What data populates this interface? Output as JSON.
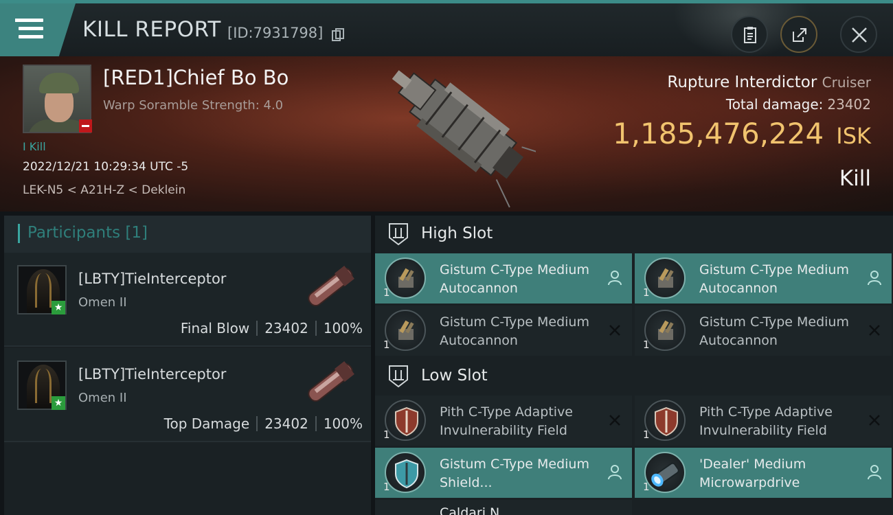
{
  "header": {
    "title": "KILL REPORT",
    "report_id": "[ID:7931798]"
  },
  "victim": {
    "name": "[RED1]Chief Bo Bo",
    "subtitle": "Warp Soramble Strength: 4.0",
    "kill_tag": "I Kill",
    "datetime": "2022/12/21 10:29:34 UTC -5",
    "location": "LEK-N5 < A21H-Z < Deklein",
    "ship_name": "Rupture Interdictor",
    "ship_class": "Cruiser",
    "total_damage_label": "Total damage:",
    "total_damage": "23402",
    "isk_value": "1,185,476,224",
    "isk_unit": "ISK",
    "status": "Kill"
  },
  "participants": {
    "label": "Participants [1]",
    "items": [
      {
        "name": "[LBTY]TieInterceptor",
        "ship": "Omen II",
        "role": "Final Blow",
        "damage": "23402",
        "percent": "100%"
      },
      {
        "name": "[LBTY]TieInterceptor",
        "ship": "Omen II",
        "role": "Top Damage",
        "damage": "23402",
        "percent": "100%"
      }
    ]
  },
  "slots": {
    "high_label": "High Slot",
    "low_label": "Low Slot",
    "high": [
      {
        "name": "Gistum C-Type Medium Autocannon",
        "qty": "1",
        "state": "dropped"
      },
      {
        "name": "Gistum C-Type Medium Autocannon",
        "qty": "1",
        "state": "dropped"
      },
      {
        "name": "Gistum C-Type Medium Autocannon",
        "qty": "1",
        "state": "destroyed"
      },
      {
        "name": "Gistum C-Type Medium Autocannon",
        "qty": "1",
        "state": "destroyed"
      }
    ],
    "low": [
      {
        "name": "Pith C-Type Adaptive Invulnerability Field",
        "qty": "1",
        "state": "destroyed"
      },
      {
        "name": "Pith C-Type Adaptive Invulnerability Field",
        "qty": "1",
        "state": "destroyed"
      },
      {
        "name": "Gistum C-Type Medium Shield...",
        "qty": "1",
        "state": "dropped"
      },
      {
        "name": "'Dealer' Medium Microwarpdrive",
        "qty": "1",
        "state": "dropped"
      }
    ],
    "peek_name": "Caldari N..."
  },
  "icons": {
    "menu": "hamburger-menu-icon",
    "copy": "copy-icon",
    "clipboard": "clipboard-icon",
    "share": "share-icon",
    "close": "close-icon",
    "slot": "slot-icon",
    "dropped": "person-icon",
    "destroyed": "x-icon"
  },
  "colors": {
    "accent": "#3c837f",
    "fitted_bg": "#3f7f7a",
    "isk": "#f1c36e",
    "kill_tag": "#3aa6a0",
    "status_badge": "#c0181b",
    "friendly_badge": "#2b9c3c"
  }
}
